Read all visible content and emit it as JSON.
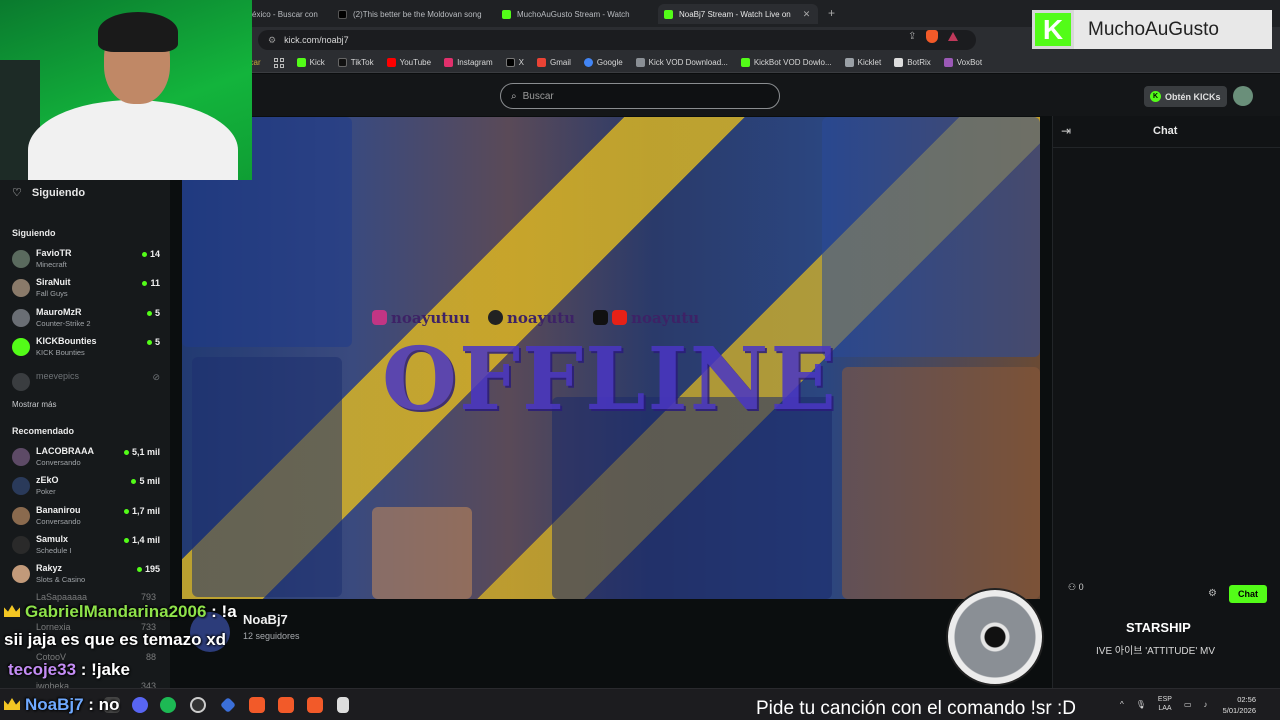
{
  "tabs": [
    {
      "label": "éxico - Buscar con",
      "active": false,
      "color": "#ffffff"
    },
    {
      "label": "(2)This better be the Moldovan song",
      "active": false,
      "color": "#000000"
    },
    {
      "label": "MuchoAuGusto Stream - Watch",
      "active": false,
      "color": "#53fc18"
    },
    {
      "label": "NoaBj7 Stream - Watch Live on",
      "active": true,
      "color": "#53fc18"
    }
  ],
  "address": {
    "url": "kick.com/noabj7"
  },
  "bookmarks": [
    {
      "label": "licar",
      "color": "#c7a93a"
    },
    {
      "label": "Kick",
      "color": "#53fc18"
    },
    {
      "label": "TikTok",
      "color": "#111111"
    },
    {
      "label": "YouTube",
      "color": "#ff0000"
    },
    {
      "label": "Instagram",
      "color": "#e1306c"
    },
    {
      "label": "X",
      "color": "#000000"
    },
    {
      "label": "Gmail",
      "color": "#ea4335"
    },
    {
      "label": "Google",
      "color": "#4285f4"
    },
    {
      "label": "Kick VOD Download...",
      "color": "#8a8f95"
    },
    {
      "label": "KickBot VOD Dowlo...",
      "color": "#53fc18"
    },
    {
      "label": "Kicklet",
      "color": "#9aa0a6"
    },
    {
      "label": "BotRix",
      "color": "#dddddd"
    },
    {
      "label": "VoxBot",
      "color": "#9b59b6"
    }
  ],
  "nav": {
    "search_placeholder": "Buscar",
    "get_kicks": "Obtén KICKs"
  },
  "sidebar": {
    "following_title": "Siguiendo",
    "following_heading": "Siguiendo",
    "following": [
      {
        "name": "FavioTR",
        "category": "Minecraft",
        "viewers": "14",
        "avatar": "#5a6a5e",
        "live": true
      },
      {
        "name": "SiraNuit",
        "category": "Fall Guys",
        "viewers": "11",
        "avatar": "#8a7a6a",
        "live": true
      },
      {
        "name": "MauroMzR",
        "category": "Counter-Strike 2",
        "viewers": "5",
        "avatar": "#6a6e74",
        "live": true
      },
      {
        "name": "KICKBounties",
        "category": "KICK Bounties",
        "viewers": "5",
        "avatar": "#53fc18",
        "live": true
      },
      {
        "name": "meevepics",
        "category": "",
        "viewers": "",
        "avatar": "#3a3d40",
        "live": false
      }
    ],
    "show_more": "Mostrar más",
    "recommended_heading": "Recomendado",
    "recommended": [
      {
        "name": "LACOBRAAA",
        "category": "Conversando",
        "viewers": "5,1 mil",
        "avatar": "#5d4a66"
      },
      {
        "name": "zEkO",
        "category": "Poker",
        "viewers": "5 mil",
        "avatar": "#2a3a5a"
      },
      {
        "name": "Bananirou",
        "category": "Conversando",
        "viewers": "1,7 mil",
        "avatar": "#8a6a4e"
      },
      {
        "name": "Samulx",
        "category": "Schedule I",
        "viewers": "1,4 mil",
        "avatar": "#2a2a2a"
      },
      {
        "name": "Rakyz",
        "category": "Slots & Casino",
        "viewers": "195",
        "avatar": "#c29a7a"
      }
    ],
    "partial_rows": [
      {
        "name": "LaSapaaaaa",
        "viewers": "793"
      },
      {
        "name": "Lornexia",
        "viewers": "733"
      },
      {
        "name": "CotooV",
        "viewers": "88"
      },
      {
        "name": "iwobeka",
        "viewers": "343"
      }
    ]
  },
  "player": {
    "offline_text": "OFFLINE",
    "socials": [
      {
        "label": "noayutuu",
        "color": "#c13584"
      },
      {
        "label": "noayutu",
        "color": "#222222"
      },
      {
        "label": "noayutu",
        "color": "#e62117"
      }
    ]
  },
  "channel": {
    "name": "NoaBj7",
    "followers": "12 seguidores"
  },
  "chat": {
    "title": "Chat",
    "count": "0",
    "button": "Chat"
  },
  "overlay": {
    "brand_letter": "K",
    "brand_name": "MuchoAuGusto",
    "chat_lines": [
      {
        "user": "GabrielMandarina2006",
        "text": " : !a"
      },
      {
        "user": "",
        "text": "sii jaja es que es temazo xd"
      },
      {
        "user": "tecoje33",
        "text": " : !jake"
      },
      {
        "user": "NoaBj7",
        "text": " : no"
      }
    ],
    "song_title": "STARSHIP",
    "song_artist": "IVE 아이브 'ATTITUDE' MV"
  },
  "taskbar": {
    "ticker": "Pide tu canción con el comando !sr :D",
    "lang_top": "ESP",
    "lang_bottom": "LAA",
    "time": "02:56",
    "date": "5/01/2026"
  }
}
